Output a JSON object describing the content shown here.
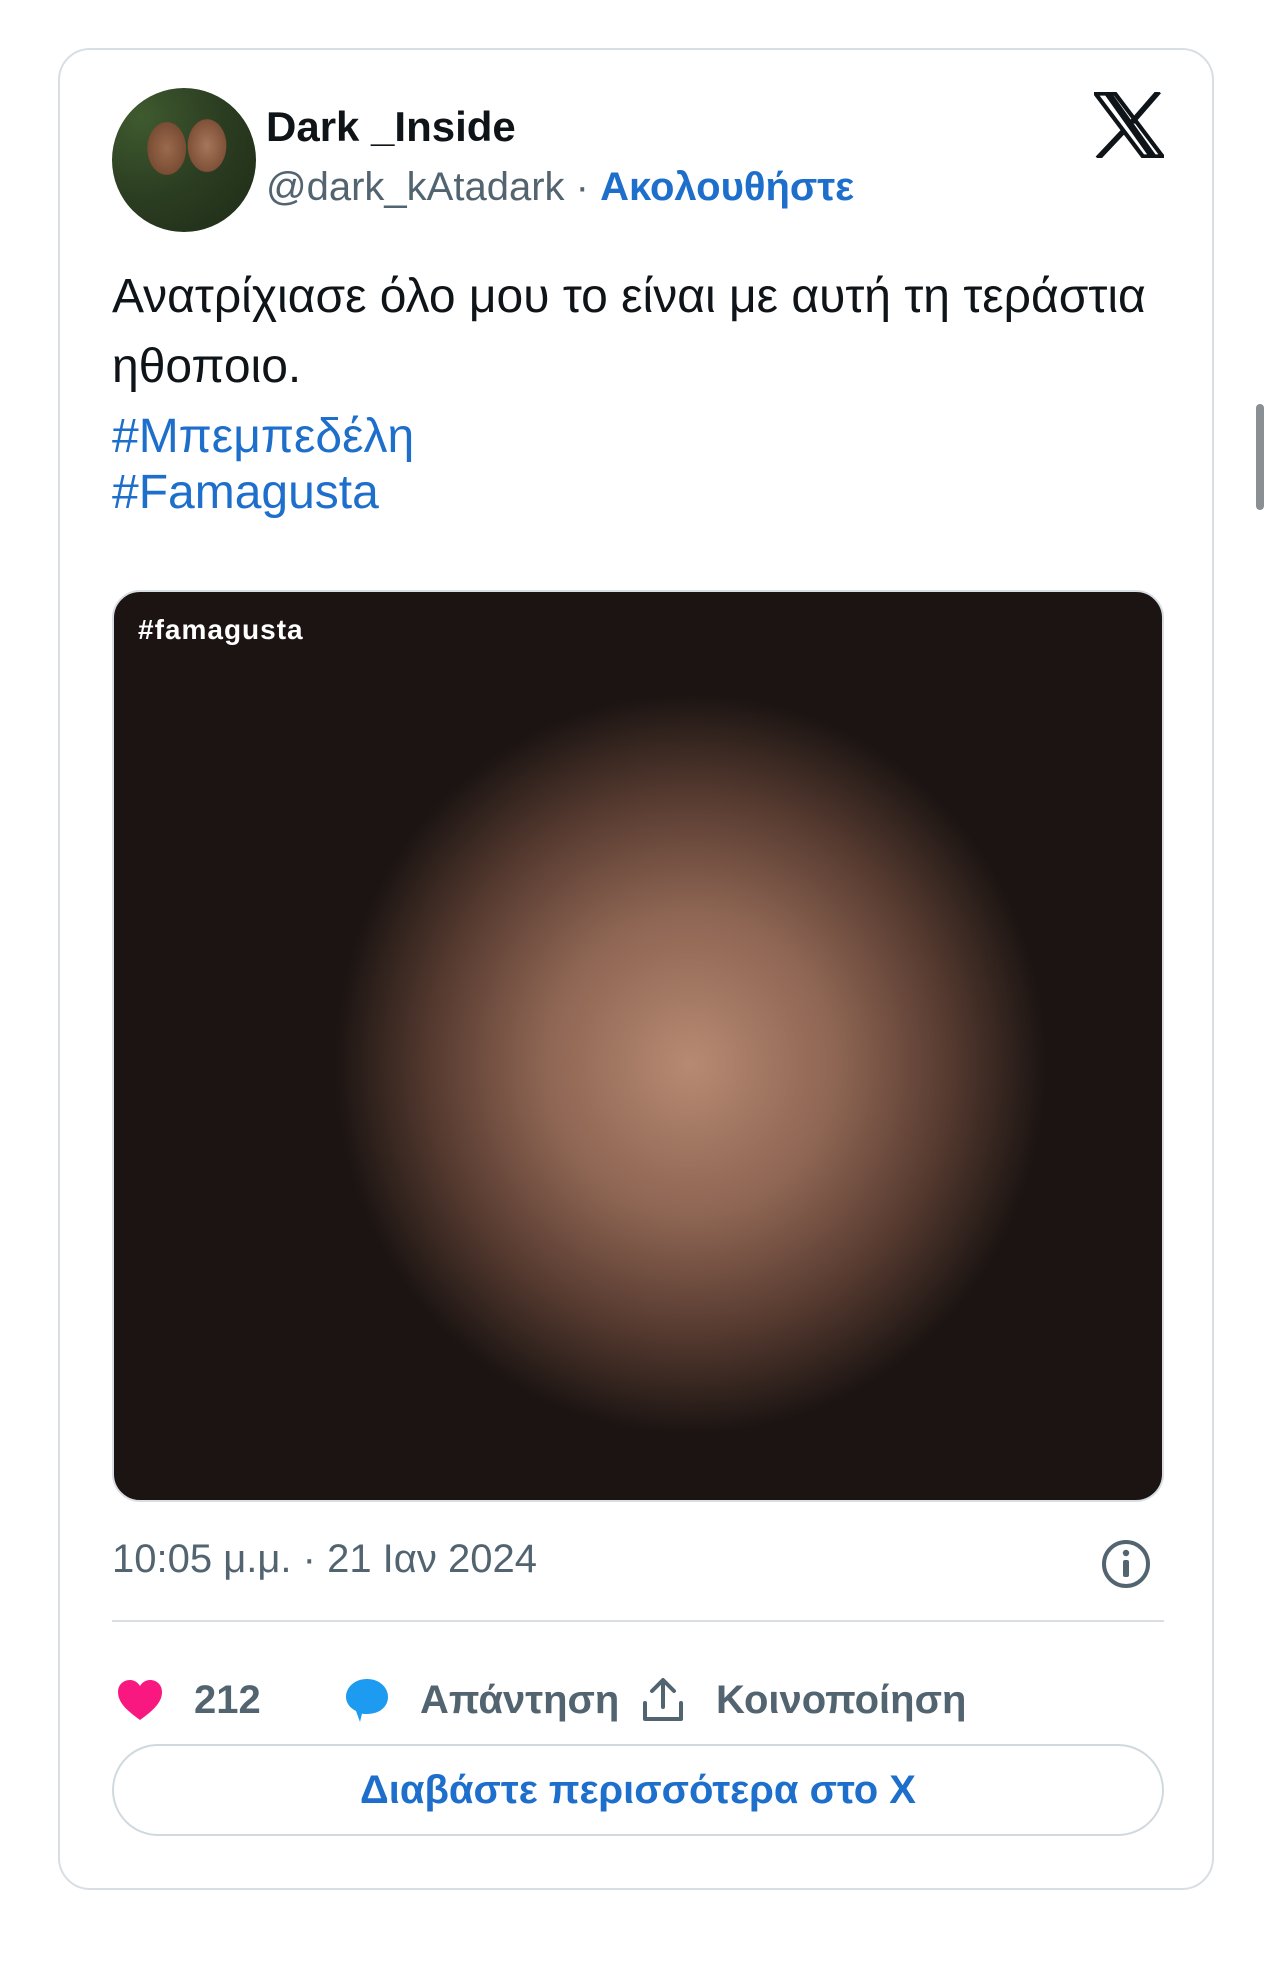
{
  "author": {
    "name": "Dark _Inside",
    "handle": "@dark_kAtadark",
    "separator": "·",
    "follow_label": "Ακολουθήστε",
    "avatar_icon": "profile-photo"
  },
  "platform": {
    "logo": "x-logo"
  },
  "tweet": {
    "text": "Ανατρίχιασε όλο μου το είναι με αυτή τη τεράστια ηθοποιο.",
    "hashtags": [
      "#Μπεμπεδέλη",
      "#Famagusta"
    ],
    "media_overlay_text": "#famagusta",
    "timestamp": "10:05 μ.μ. · 21 Ιαν 2024"
  },
  "actions": {
    "like_count": "212",
    "reply_label": "Απάντηση",
    "share_label": "Κοινοποίηση"
  },
  "read_more_label": "Διαβάστε περισσότερα στο X",
  "colors": {
    "accent": "#1d6fcb",
    "like": "#f91880",
    "reply": "#1d9bf0",
    "muted": "#536471",
    "border": "#d8dee3"
  }
}
